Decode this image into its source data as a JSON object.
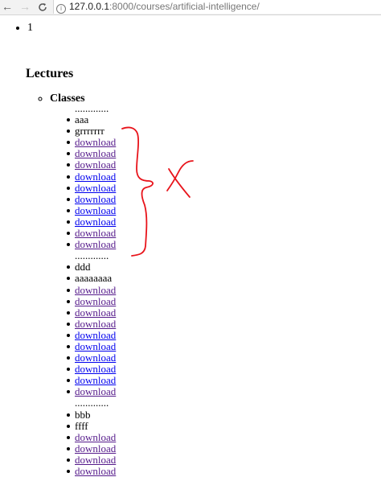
{
  "browser": {
    "back_icon": "←",
    "forward_icon": "→",
    "reload_icon": "C",
    "info_icon": "i",
    "url_host": "127.0.0.1",
    "url_path": ":8000/courses/artificial-intelligence/"
  },
  "top_list": [
    "",
    "1"
  ],
  "heading": "Lectures",
  "classes_label": "Classes",
  "groups": [
    {
      "separator": ".............",
      "a": "aaa",
      "b": "grrrrrrr",
      "links": [
        "download",
        "download",
        "download",
        "download",
        "download",
        "download",
        "download",
        "download",
        "download",
        "download"
      ]
    },
    {
      "separator": ".............",
      "a": "ddd",
      "b": "aaaaaaaa",
      "links": [
        "download",
        "download",
        "download",
        "download",
        "download",
        "download",
        "download",
        "download",
        "download",
        "download"
      ]
    },
    {
      "separator": ".............",
      "a": "bbb",
      "b": "ffff",
      "links": [
        "download",
        "download",
        "download",
        "download"
      ]
    }
  ],
  "annotation": {
    "mark": "X",
    "color": "#e8141b"
  }
}
